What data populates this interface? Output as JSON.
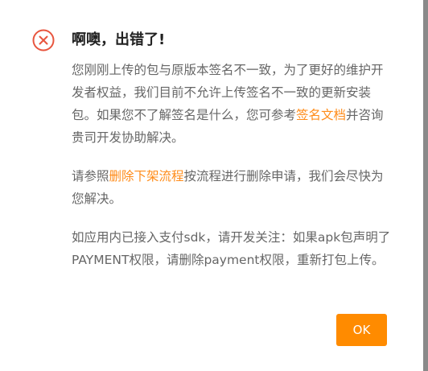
{
  "dialog": {
    "title": "啊噢，出错了!",
    "icon": "error-circle-x-icon",
    "accent_color": "#ff8b00",
    "error_color": "#e8553e",
    "paragraph1": {
      "text_before": "您刚刚上传的包与原版本签名不一致，为了更好的维护开发者权益，我们目前不允许上传签名不一致的更新安装包。如果您不了解签名是什么，您可参考",
      "link": "签名文档",
      "text_after": "并咨询贵司开发协助解决。"
    },
    "paragraph2": {
      "text_before": "请参照",
      "link": "删除下架流程",
      "text_after": "按流程进行删除申请，我们会尽快为您解决。"
    },
    "paragraph3": {
      "text": "如应用内已接入支付sdk，请开发关注：如果apk包声明了PAYMENT权限，请删除payment权限，重新打包上传。"
    },
    "ok_label": "OK"
  }
}
